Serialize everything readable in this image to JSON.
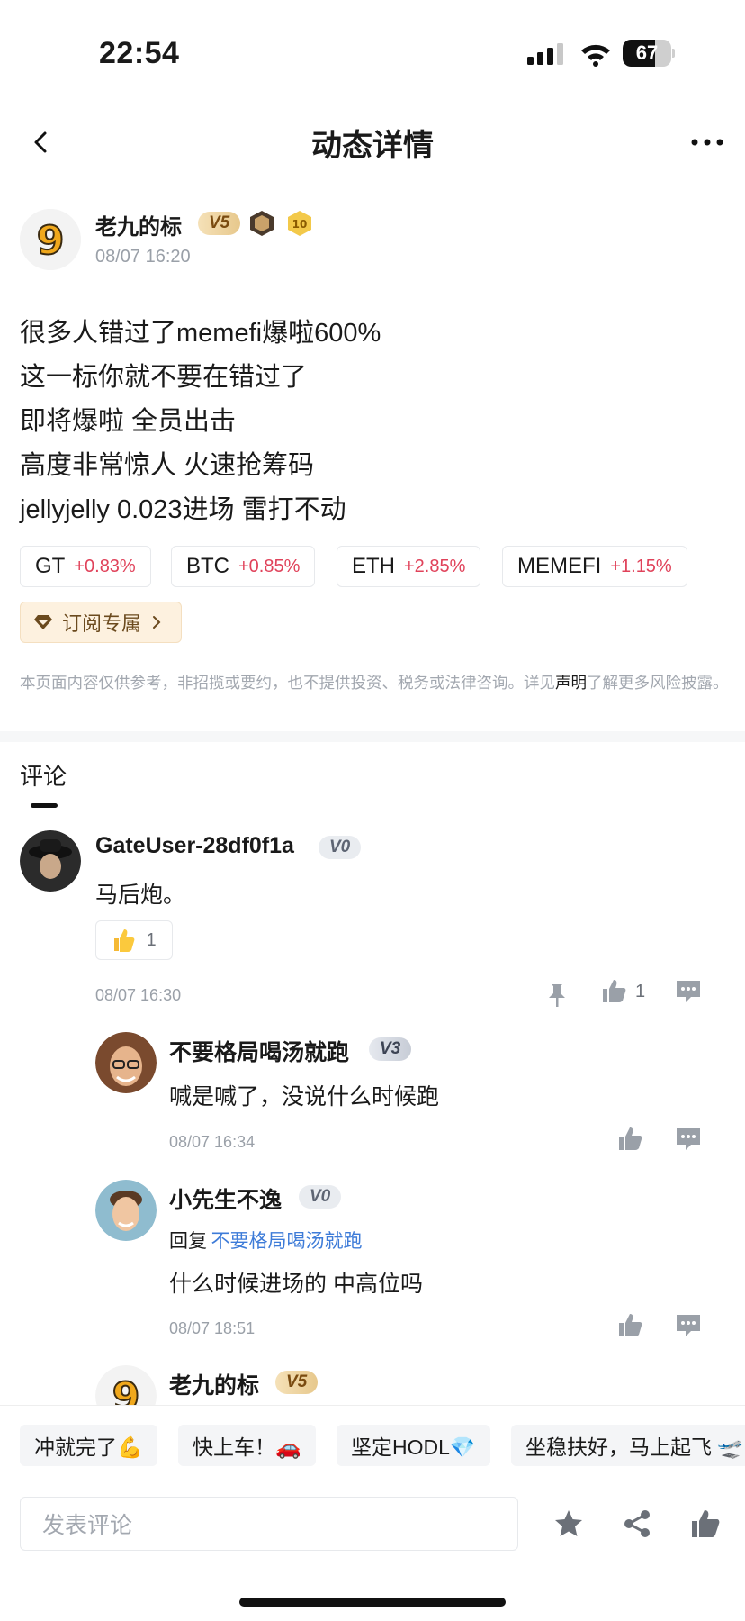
{
  "status_bar": {
    "time": "22:54",
    "battery": "67",
    "battery_level": 0.67
  },
  "nav": {
    "title": "动态详情",
    "back_icon": "chevron-left-icon",
    "more_icon": "more-horizontal-icon"
  },
  "post": {
    "author": {
      "name": "老九的标",
      "level": "V5",
      "avatar_glyph": "9",
      "badge_level": "10"
    },
    "time": "08/07 16:20",
    "lines": [
      "很多人错过了memefi爆啦600%",
      "这一标你就不要在错过了",
      "即将爆啦 全员出击",
      "高度非常惊人 火速抢筹码",
      "jellyjelly 0.023进场 雷打不动"
    ],
    "coins": [
      {
        "symbol": "GT",
        "change": "+0.83%"
      },
      {
        "symbol": "BTC",
        "change": "+0.85%"
      },
      {
        "symbol": "ETH",
        "change": "+2.85%"
      },
      {
        "symbol": "MEMEFI",
        "change": "+1.15%"
      }
    ],
    "subscribe_label": "订阅专属",
    "disclaimer_before": "本页面内容仅供参考，非招揽或要约，也不提供投资、税务或法律咨询。详见",
    "disclaimer_link": "声明",
    "disclaimer_after": "了解更多风险披露。"
  },
  "comments_heading": "评论",
  "comments": [
    {
      "name": "GateUser-28df0f1a",
      "level": "V0",
      "text": "马后炮。",
      "reaction_count": "1",
      "time": "08/07 16:30",
      "like_count": "1",
      "replies": [
        {
          "name": "不要格局喝汤就跑",
          "level": "V3",
          "text": "喊是喊了，没说什么时候跑",
          "time": "08/07 16:34"
        },
        {
          "name": "小先生不逸",
          "level": "V0",
          "reply_prefix": "回复",
          "reply_to": "不要格局喝汤就跑",
          "text": "什么时候进场的 中高位吗",
          "time": "08/07 18:51"
        },
        {
          "name": "老九的标",
          "level": "V5"
        }
      ]
    }
  ],
  "quick_replies": [
    "冲就完了💪",
    "快上车！🚗",
    "坚定HODL💎",
    "坐稳扶好，马上起飞 🛫"
  ],
  "composer": {
    "placeholder": "发表评论"
  },
  "colors": {
    "rise": "#e0425a",
    "link": "#3d7bd8",
    "muted": "#9aa0a8"
  }
}
